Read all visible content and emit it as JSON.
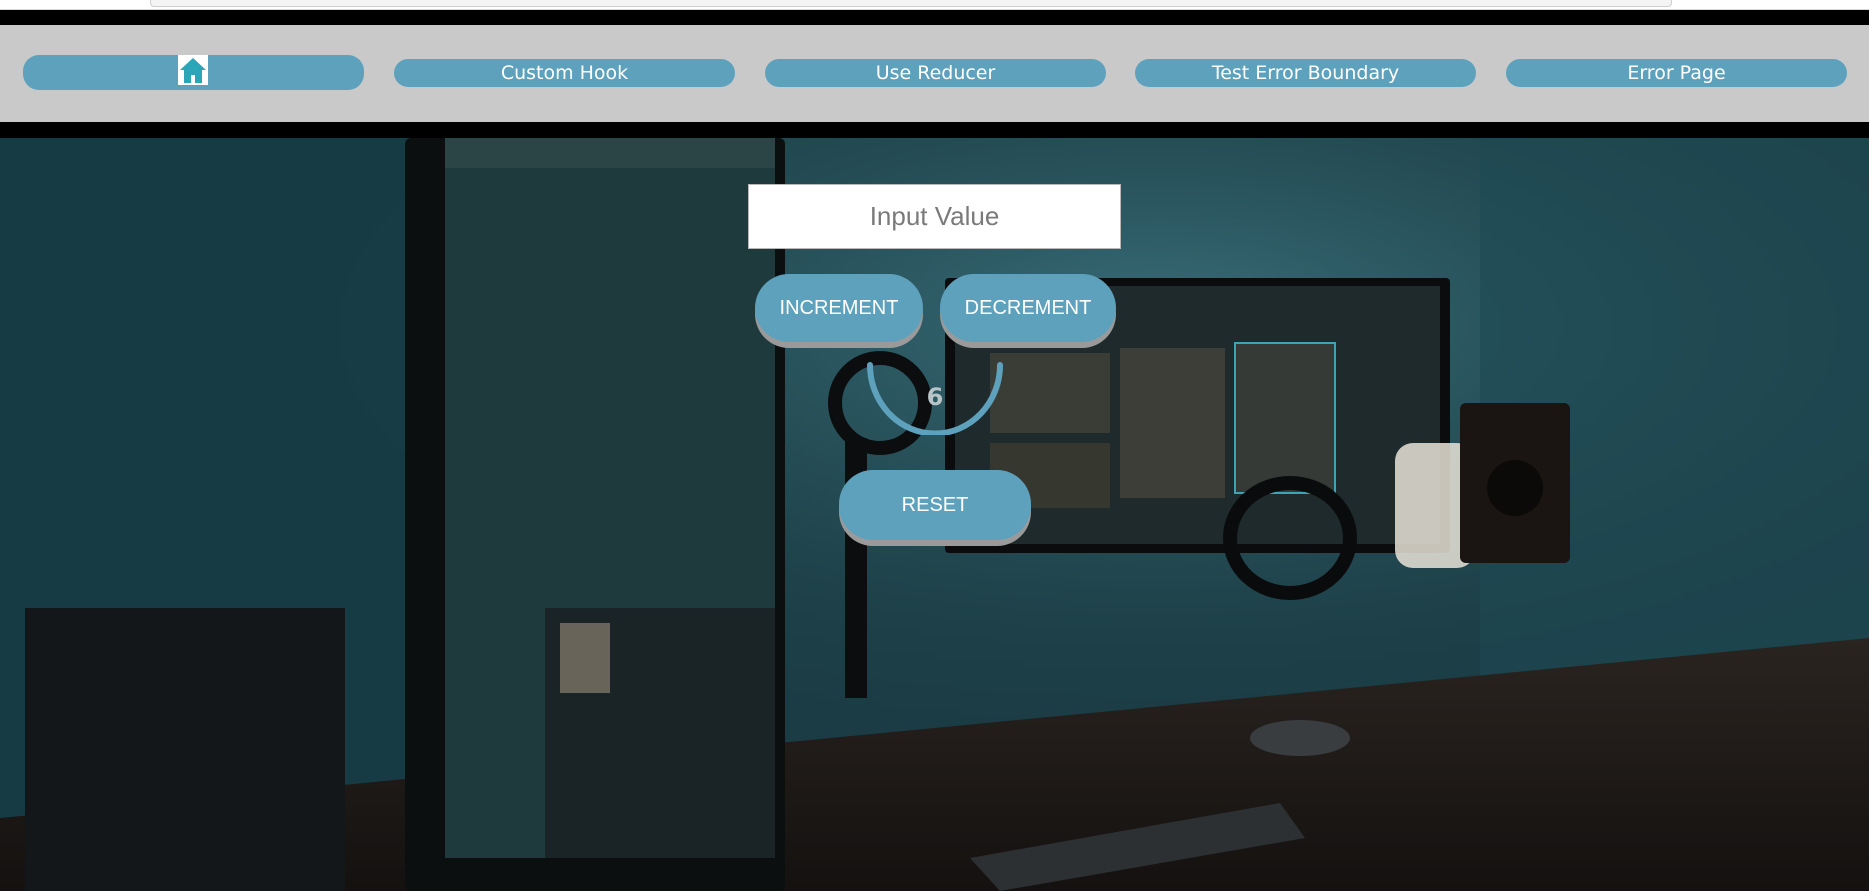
{
  "nav": {
    "home_icon": "home-icon",
    "items": [
      {
        "label": "Custom Hook"
      },
      {
        "label": "Use Reducer"
      },
      {
        "label": "Test Error Boundary"
      },
      {
        "label": "Error Page"
      }
    ]
  },
  "counter": {
    "input_placeholder": "Input Value",
    "increment_label": "INCREMENT",
    "decrement_label": "DECREMENT",
    "value": "6",
    "reset_label": "RESET"
  },
  "colors": {
    "accent": "#5ea1bd",
    "nav_background": "#c9c9c9"
  }
}
